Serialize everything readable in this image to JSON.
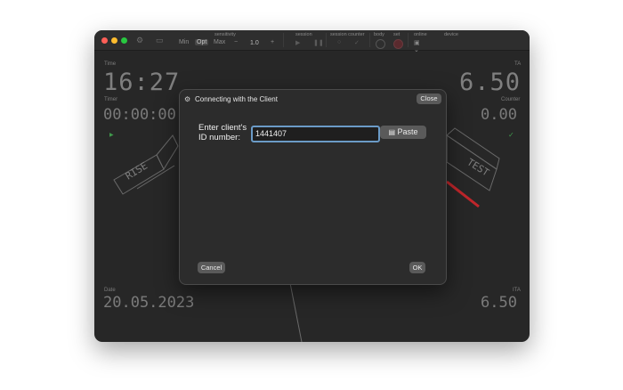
{
  "toolbar": {
    "sensitivity_label": "sensitivity",
    "min": "Min",
    "opt": "Opt",
    "max": "Max",
    "minus": "−",
    "value": "1.0",
    "plus": "+",
    "session_label": "session",
    "session_counter_label": "session counter",
    "body_label": "body",
    "set_label": "set",
    "online_label": "online",
    "device_label": "device"
  },
  "display": {
    "time_label": "Time",
    "time_value": "16:27",
    "timer_label": "Timer",
    "timer_value": "00:00:00",
    "ta_label": "TA",
    "ta_value": "6.50",
    "counter_label": "Counter",
    "counter_value": "0.00",
    "date_label": "Date",
    "date_value": "20.05.2023",
    "ita_label": "ITA",
    "ita_value": "6.50",
    "rise": "RISE",
    "test": "TEST"
  },
  "dialog": {
    "title": "Connecting with the Client",
    "close": "Close",
    "prompt_line1": "Enter client's",
    "prompt_line2": "ID number:",
    "id_value": "1441407",
    "paste": "Paste",
    "cancel": "Cancel",
    "ok": "OK"
  },
  "colors": {
    "window_bg": "#272727",
    "input_border": "#6b9bc7",
    "gauge_red": "#c0262b",
    "indicator_green": "#3f9a4c"
  },
  "icons": [
    "settings-icon",
    "sidebar-icon",
    "play-icon",
    "pause-icon",
    "paste-icon",
    "dialog-icon"
  ]
}
